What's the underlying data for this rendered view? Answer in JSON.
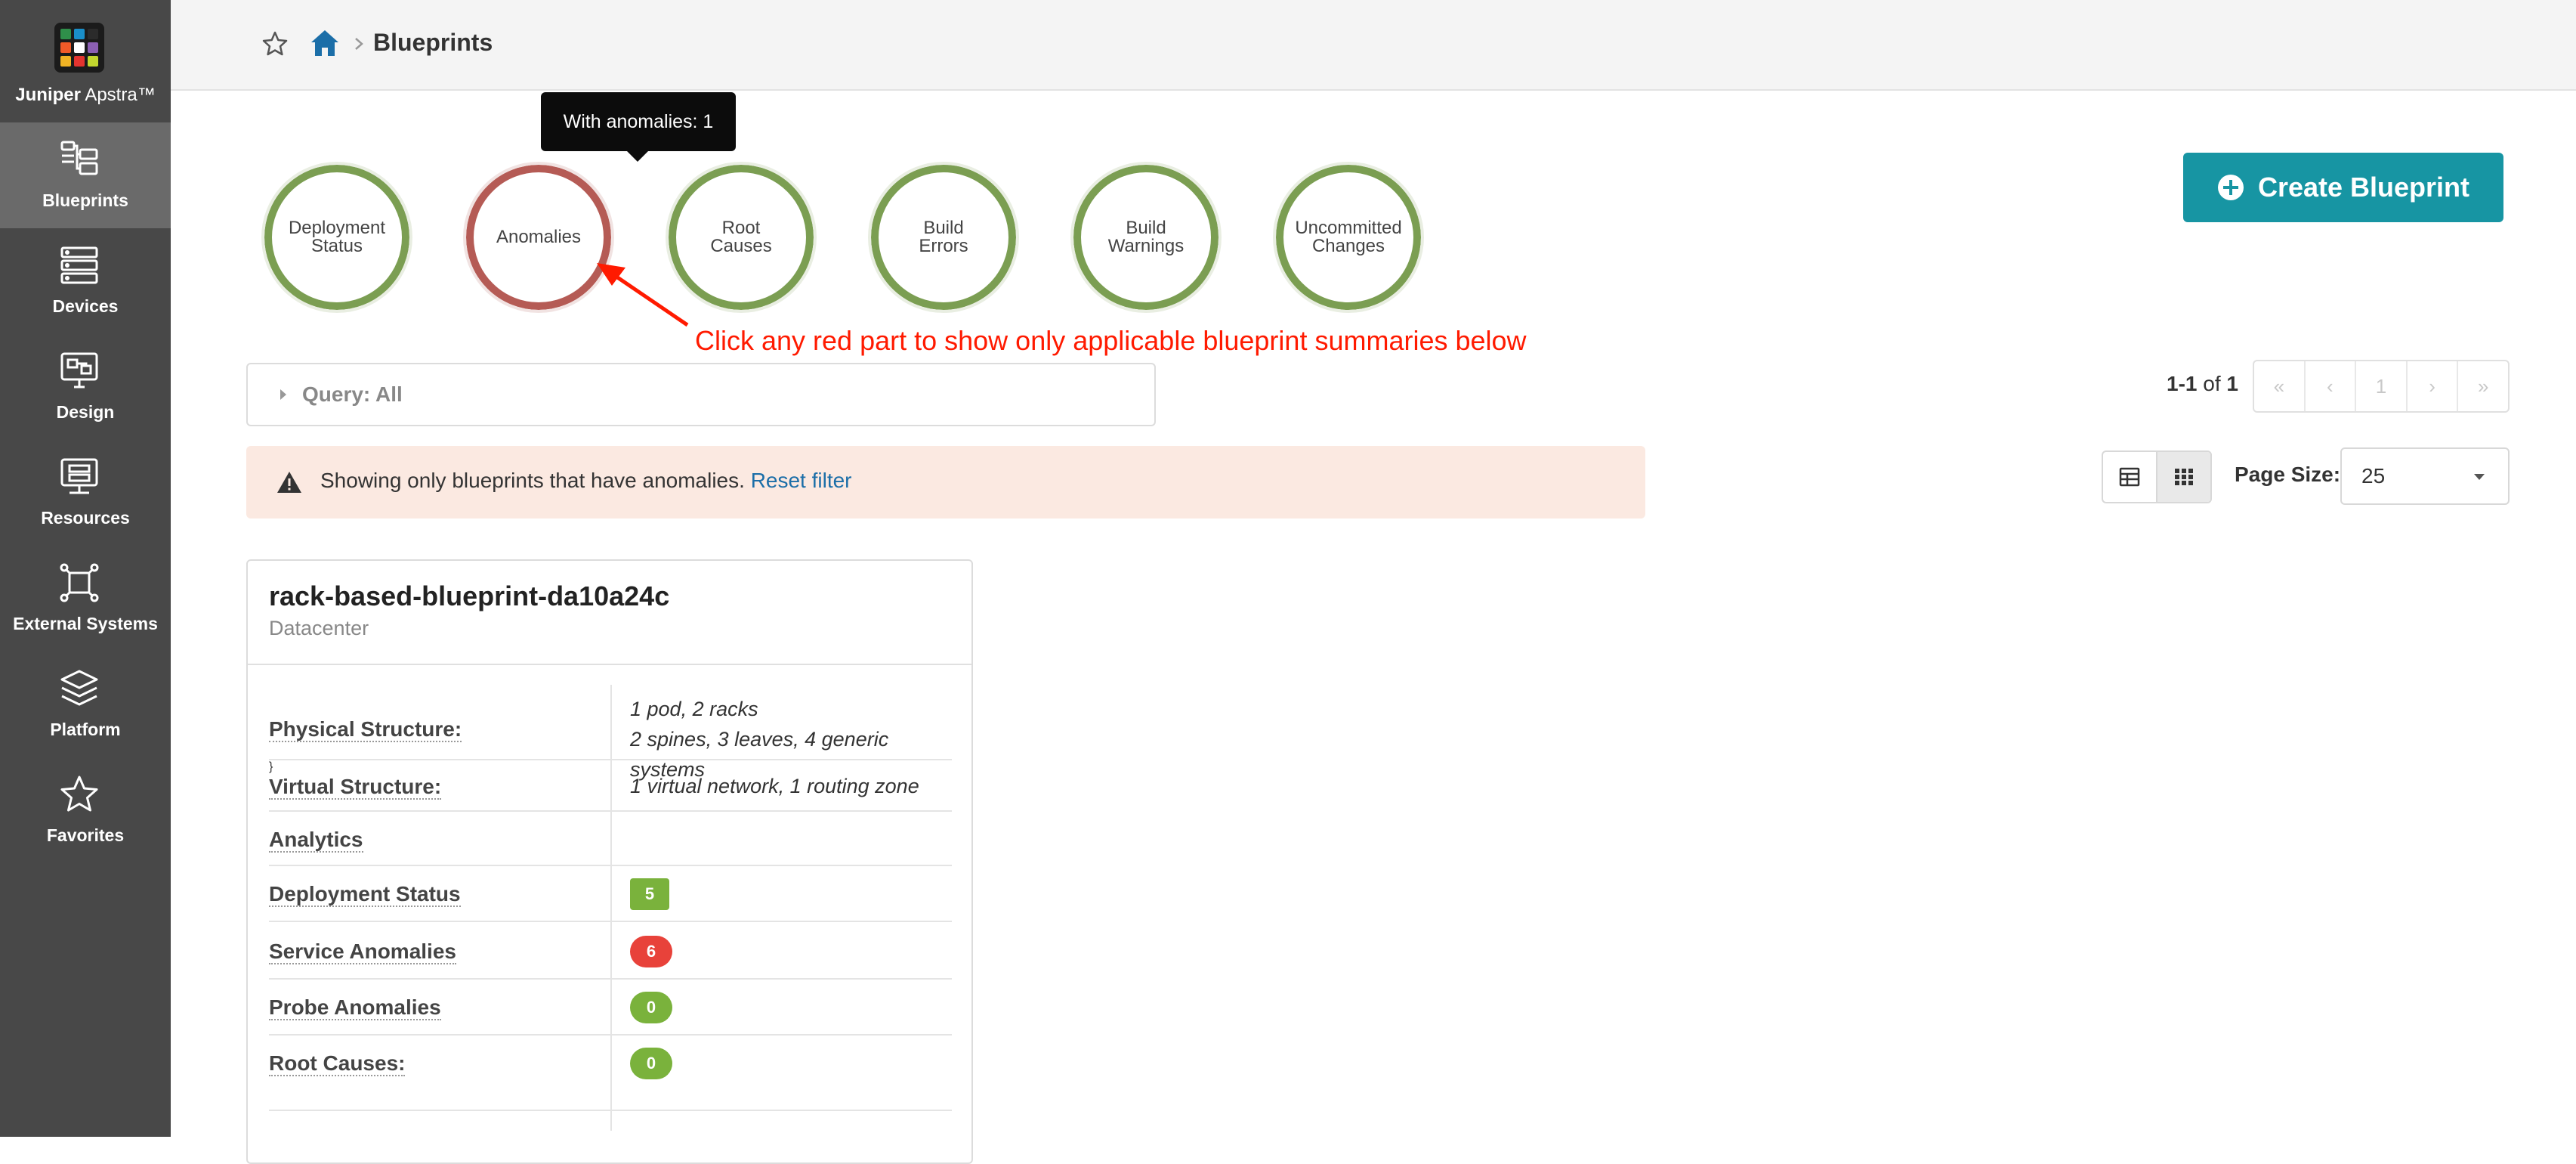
{
  "brand": {
    "name_bold": "Juniper",
    "name_rest": " Apstra™"
  },
  "sidebar": {
    "items": [
      {
        "label": "Blueprints",
        "icon": "blueprints-icon",
        "active": true
      },
      {
        "label": "Devices",
        "icon": "devices-icon"
      },
      {
        "label": "Design",
        "icon": "design-icon"
      },
      {
        "label": "Resources",
        "icon": "resources-icon"
      },
      {
        "label": "External Systems",
        "icon": "external-systems-icon"
      },
      {
        "label": "Platform",
        "icon": "platform-icon"
      },
      {
        "label": "Favorites",
        "icon": "favorites-icon"
      }
    ]
  },
  "header": {
    "breadcrumb": "Blueprints"
  },
  "summary": {
    "circles": [
      {
        "line1": "Deployment",
        "line2": "Status",
        "state": "ok"
      },
      {
        "line1": "Anomalies",
        "line2": "",
        "state": "error"
      },
      {
        "line1": "Root",
        "line2": "Causes",
        "state": "ok"
      },
      {
        "line1": "Build",
        "line2": "Errors",
        "state": "ok"
      },
      {
        "line1": "Build",
        "line2": "Warnings",
        "state": "ok"
      },
      {
        "line1": "Uncommitted",
        "line2": "Changes",
        "state": "ok"
      }
    ],
    "tooltip": "With anomalies: 1"
  },
  "annotation": {
    "text": "Click any red part to show only applicable blueprint summaries below"
  },
  "actions": {
    "create_label": "Create Blueprint"
  },
  "query": {
    "label": "Query: All"
  },
  "alert": {
    "text": "Showing only blueprints that have anomalies.",
    "link": "Reset filter"
  },
  "pagination": {
    "range": "1-1",
    "of_word": "of",
    "total": "1",
    "buttons": [
      "«",
      "‹",
      "1",
      "›",
      "»"
    ],
    "page_size_label": "Page Size:",
    "page_size": "25"
  },
  "blueprint": {
    "name": "rack-based-blueprint-da10a24c",
    "type": "Datacenter",
    "physical_label": "Physical Structure:",
    "physical_line1": "1 pod, 2 racks",
    "physical_line2": "2 spines, 3 leaves, 4 generic systems",
    "virtual_label": "Virtual Structure:",
    "virtual_value": "1 virtual network, 1 routing zone",
    "analytics_label": "Analytics",
    "deployment_label": "Deployment Status",
    "deployment_value": "5",
    "service_label": "Service Anomalies",
    "service_value": "6",
    "probe_label": "Probe Anomalies",
    "probe_value": "0",
    "root_label": "Root Causes:",
    "root_value": "0"
  },
  "colors": {
    "sidebar_bg": "#484848",
    "accent": "#1795a3",
    "ok_green": "#7b9e52",
    "error_red": "#b55b55",
    "badge_green": "#7ab23c",
    "badge_red": "#e8423a",
    "link_blue": "#1b6ea8",
    "annotation_red": "#ff1a00"
  }
}
